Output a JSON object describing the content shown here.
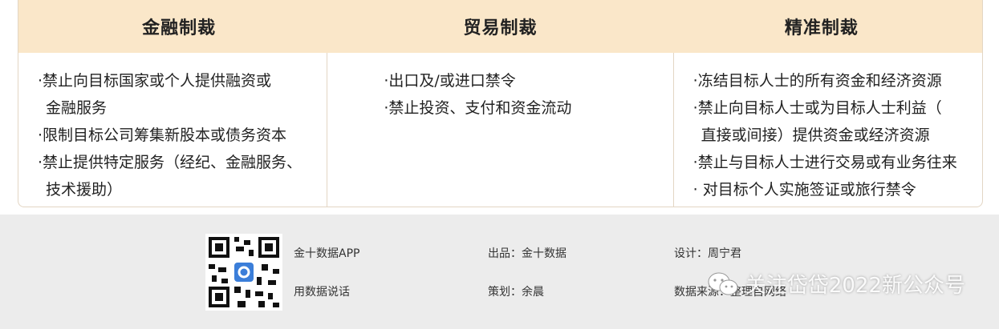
{
  "headers": [
    "金融制裁",
    "贸易制裁",
    "精准制裁"
  ],
  "columns": [
    {
      "items": [
        {
          "line1": "·禁止向目标国家或个人提供融资或",
          "line2": "金融服务"
        },
        {
          "line1": "·限制目标公司筹集新股本或债务资本",
          "line2": ""
        },
        {
          "line1": "·禁止提供特定服务（经纪、金融服务、",
          "line2": "技术援助）"
        }
      ]
    },
    {
      "items": [
        {
          "line1": "·出口及/或进口禁令",
          "line2": ""
        },
        {
          "line1": "·禁止投资、支付和资金流动",
          "line2": ""
        }
      ]
    },
    {
      "items": [
        {
          "line1": "·冻结目标人士的所有资金和经济资源",
          "line2": ""
        },
        {
          "line1": "·禁止向目标人士或为目标人士利益（",
          "line2": "直接或间接）提供资金或经济资源"
        },
        {
          "line1": "·禁止与目标人士进行交易或有业务往来",
          "line2": ""
        },
        {
          "line1": "· 对目标个人实施签证或旅行禁令",
          "line2": ""
        }
      ]
    }
  ],
  "footer": {
    "app_name": "金十数据APP",
    "slogan": "用数据说话",
    "producer": "出品：金十数据",
    "planner": "策划：余晨",
    "designer": "设计：周宁君",
    "source": "数据来源：整理自网络",
    "watermark": "关注岱岱2022新公众号",
    "icons": {
      "qr": "qr-code-icon",
      "wechat": "wechat-icon"
    }
  }
}
